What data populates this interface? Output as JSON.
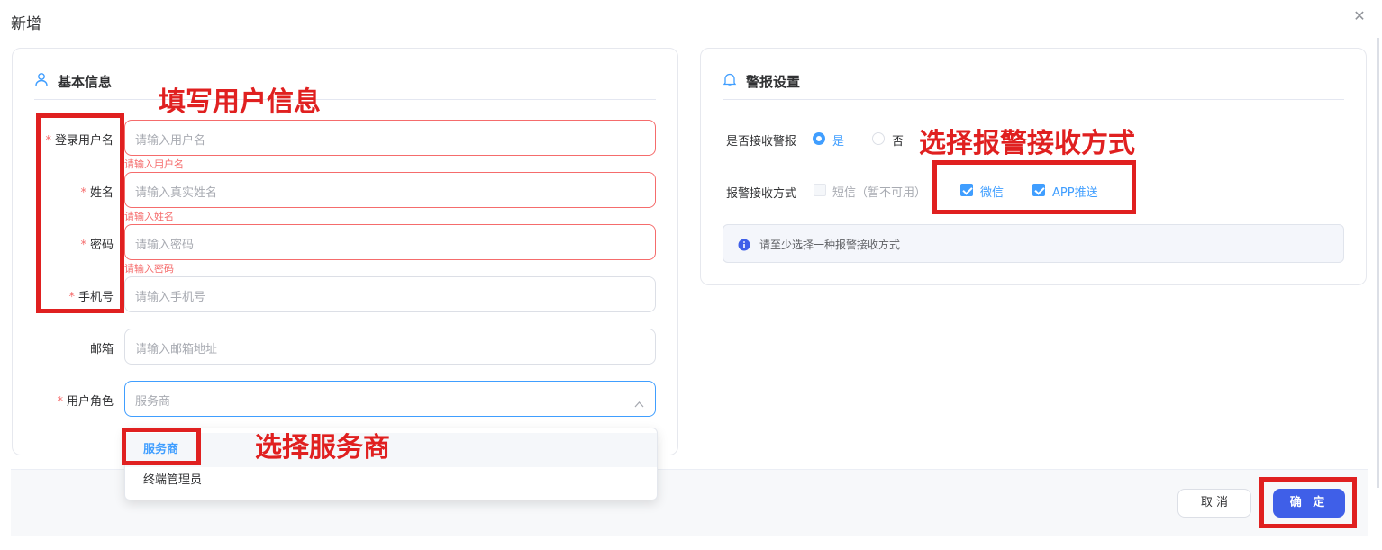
{
  "dialog": {
    "title": "新增",
    "close": "✕"
  },
  "basic": {
    "title": "基本信息",
    "fields": [
      {
        "label": "登录用户名",
        "required": "*",
        "placeholder": "请输入用户名",
        "error": "请输入用户名"
      },
      {
        "label": "姓名",
        "required": "*",
        "placeholder": "请输入真实姓名",
        "error": "请输入姓名"
      },
      {
        "label": "密码",
        "required": "*",
        "placeholder": "请输入密码",
        "error": "请输入密码"
      },
      {
        "label": "手机号",
        "required": "*",
        "placeholder": "请输入手机号",
        "error": ""
      },
      {
        "label": "邮箱",
        "required": "",
        "placeholder": "请输入邮箱地址",
        "error": ""
      },
      {
        "label": "用户角色",
        "required": "*",
        "placeholder": "服务商",
        "error": ""
      }
    ],
    "role_options": [
      "服务商",
      "终端管理员"
    ],
    "role_selected": "服务商"
  },
  "alarm": {
    "title": "警报设置",
    "receive_label": "是否接收警报",
    "receive_options": [
      "是",
      "否"
    ],
    "receive_selected": "是",
    "method_label": "报警接收方式",
    "methods": [
      {
        "label": "短信（暂不可用）",
        "checked": false,
        "disabled": true
      },
      {
        "label": "微信",
        "checked": true,
        "disabled": false
      },
      {
        "label": "APP推送",
        "checked": true,
        "disabled": false
      }
    ],
    "info": "请至少选择一种报警接收方式"
  },
  "footer": {
    "cancel": "取 消",
    "confirm": "确 定"
  },
  "annotations": {
    "fill_user_info": "填写用户信息",
    "select_method": "选择报警接收方式",
    "select_provider": "选择服务商"
  },
  "colors": {
    "primary": "#409eff",
    "confirm": "#3f5fe8",
    "error": "#f56c6c",
    "annotation": "#e02020"
  }
}
